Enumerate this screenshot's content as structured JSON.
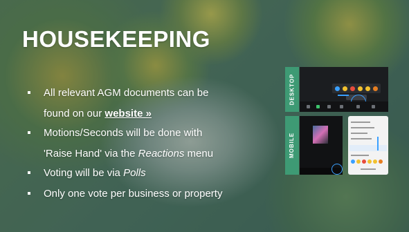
{
  "slide": {
    "title": "HOUSEKEEPING",
    "bullets": [
      {
        "before": "All relevant AGM documents can be"
      },
      {
        "before": "found on our ",
        "link": "website »",
        "continuation": true
      },
      {
        "before": "Motions/Seconds will be done with"
      },
      {
        "before": "'Raise Hand' via the ",
        "emphasis": "Reactions",
        "after": " menu",
        "continuation": true
      },
      {
        "before": "Voting will be via ",
        "emphasis": "Polls"
      },
      {
        "before": "Only one vote per business or property"
      }
    ],
    "screenshots": {
      "desktop_tag": "DESKTOP",
      "mobile_tag": "MOBILE"
    }
  },
  "colors": {
    "title": "#ffffff",
    "tag_background": "#3e9a74",
    "highlight_ring": "#3aa0ff"
  }
}
